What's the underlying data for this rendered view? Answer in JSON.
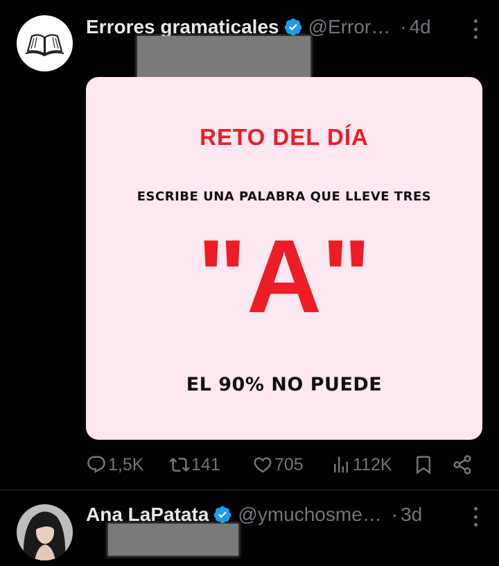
{
  "tweets": [
    {
      "display_name": "Errores gramaticales",
      "handle": "@Error…",
      "separator": "·",
      "time": "4d",
      "media": {
        "title": "RETO DEL DÍA",
        "subtitle": "ESCRIBE UNA PALABRA QUE LLEVE  TRES",
        "big": "\"A\"",
        "bottom": "EL 90% NO PUEDE"
      },
      "actions": {
        "replies": "1,5K",
        "reposts": "141",
        "likes": "705",
        "views": "112K"
      }
    },
    {
      "display_name": "Ana LaPatata",
      "handle": "@ymuchosme…",
      "separator": "·",
      "time": "3d"
    }
  ],
  "colors": {
    "verified": "#1d9bf0",
    "media_bg": "#fde7f0",
    "accent_red": "#ee1c25",
    "muted": "#71767b"
  },
  "icons": [
    "book-icon",
    "verified-icon",
    "more-icon",
    "reply-icon",
    "repost-icon",
    "like-icon",
    "views-icon",
    "bookmark-icon",
    "share-icon"
  ]
}
